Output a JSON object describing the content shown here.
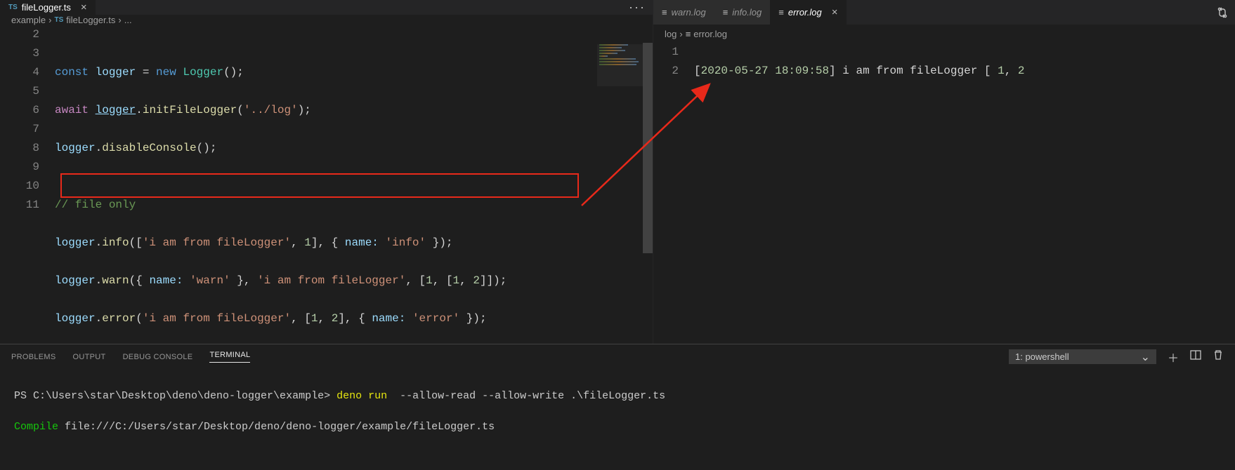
{
  "left": {
    "tab": {
      "badge": "TS",
      "name": "fileLogger.ts"
    },
    "breadcrumb": {
      "a": "example",
      "badge": "TS",
      "b": "fileLogger.ts",
      "tail": "..."
    },
    "lines": [
      "2",
      "3",
      "4",
      "5",
      "6",
      "7",
      "8",
      "9",
      "10",
      "11"
    ],
    "code": {
      "l3": {
        "t1": "const",
        "t2": "logger",
        "t3": " = ",
        "t4": "new",
        "t5": "Logger",
        "t6": "();"
      },
      "l4": {
        "t1": "await",
        "t2": "logger",
        "t3": ".",
        "t4": "initFileLogger",
        "t5": "(",
        "t6": "'../log'",
        "t7": ");"
      },
      "l5": {
        "t1": "logger",
        "t2": ".",
        "t3": "disableConsole",
        "t4": "();"
      },
      "l7": {
        "t1": "// file only"
      },
      "l8": {
        "t1": "logger",
        "t2": ".",
        "t3": "info",
        "t4": "([",
        "t5": "'i am from fileLogger'",
        "t6": ", ",
        "t7": "1",
        "t8": "], { ",
        "t9": "name:",
        "t10": " ",
        "t11": "'info'",
        "t12": " });"
      },
      "l9": {
        "t1": "logger",
        "t2": ".",
        "t3": "warn",
        "t4": "({ ",
        "t5": "name:",
        "t6": " ",
        "t7": "'warn'",
        "t8": " }, ",
        "t9": "'i am from fileLogger'",
        "t10": ", [",
        "t11": "1",
        "t12": ", [",
        "t13": "1",
        "t14": ", ",
        "t15": "2",
        "t16": "]]);"
      },
      "l10": {
        "t1": "logger",
        "t2": ".",
        "t3": "error",
        "t4": "(",
        "t5": "'i am from fileLogger'",
        "t6": ", [",
        "t7": "1",
        "t8": ", ",
        "t9": "2",
        "t10": "], { ",
        "t11": "name:",
        "t12": " ",
        "t13": "'error'",
        "t14": " });"
      }
    }
  },
  "right": {
    "tabs": [
      {
        "name": "warn.log",
        "active": false
      },
      {
        "name": "info.log",
        "active": false
      },
      {
        "name": "error.log",
        "active": true
      }
    ],
    "breadcrumb": {
      "a": "log",
      "b": "error.log"
    },
    "lines": [
      "1",
      "2"
    ],
    "log": {
      "l1": {
        "br1": "[",
        "ts": "2020-05-27 18:09:58",
        "br2": "]",
        "msg": " i am from fileLogger [ ",
        "n1": "1",
        "c": ", ",
        "n2": "2"
      }
    }
  },
  "panel": {
    "tabs": {
      "problems": "PROBLEMS",
      "output": "OUTPUT",
      "debug": "DEBUG CONSOLE",
      "terminal": "TERMINAL"
    },
    "select": "1: powershell",
    "term": {
      "l1": {
        "a": "PS C:\\Users\\star\\Desktop\\deno\\deno-logger\\example> ",
        "b": "deno run ",
        "c": " --allow-read --allow-write ",
        "d": ".\\fileLogger.ts"
      },
      "l2": {
        "a": "Compile",
        "b": " file:///C:/Users/star/Desktop/deno/deno-logger/example/fileLogger.ts"
      }
    }
  },
  "icons": {
    "more": "···",
    "close": "×"
  }
}
